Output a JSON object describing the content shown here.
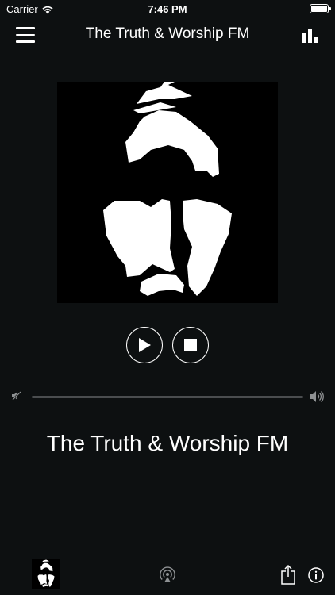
{
  "status_bar": {
    "carrier": "Carrier",
    "time": "7:46 PM",
    "battery_level": 1.0
  },
  "nav": {
    "title": "The Truth & Worship FM"
  },
  "player": {
    "station_name": "The Truth & Worship FM"
  },
  "colors": {
    "background": "#0d1011",
    "foreground": "#ffffff",
    "track": "#4a4d4f"
  },
  "icons": {
    "menu": "hamburger-menu-icon",
    "equalizer": "equalizer-icon",
    "play": "play-icon",
    "stop": "stop-icon",
    "volume_min": "volume-mute-icon",
    "volume_max": "volume-high-icon",
    "airplay": "airplay-icon",
    "share": "share-icon",
    "info": "info-icon"
  }
}
